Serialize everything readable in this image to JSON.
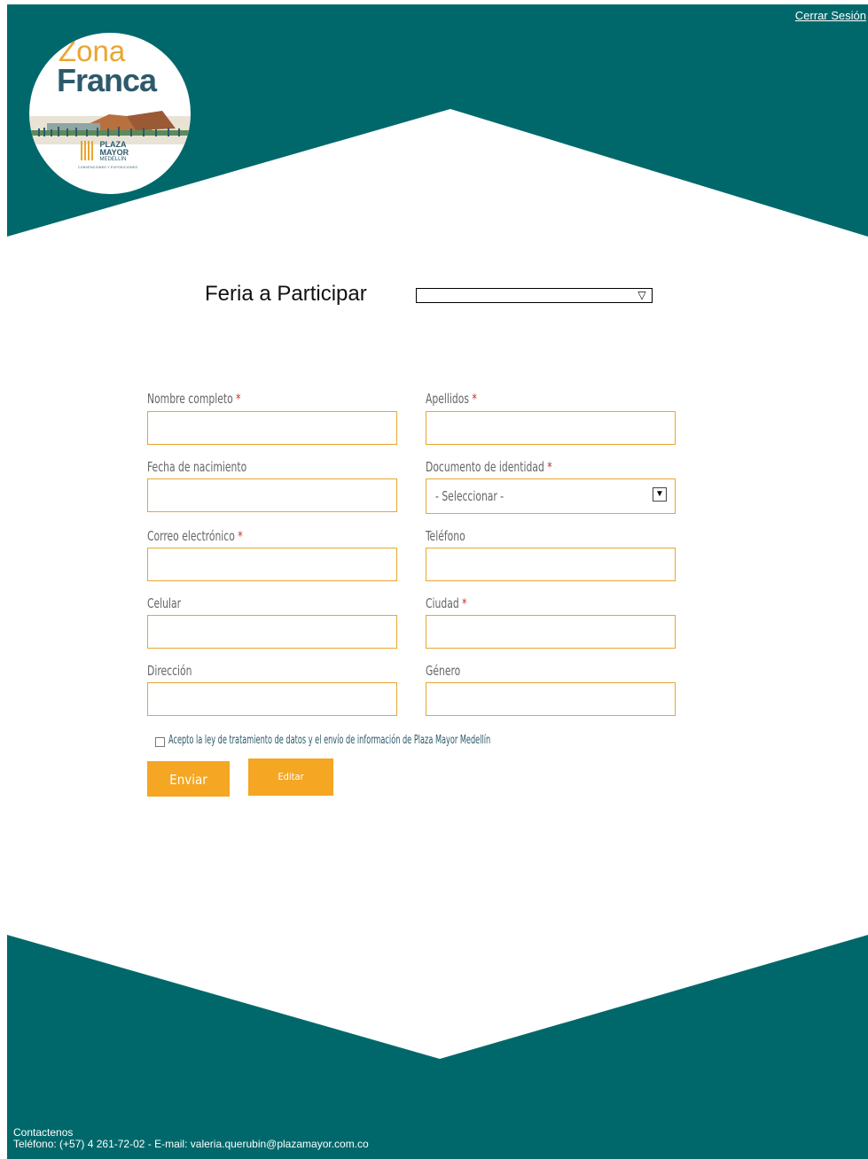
{
  "colors": {
    "teal": "#00686b",
    "orange": "#f5a623",
    "input_border": "#e8a630",
    "label": "#666666",
    "required": "#c0392b"
  },
  "header": {
    "logout_label": "Cerrar Sesión"
  },
  "logo": {
    "line1": "Zona",
    "line2": "Franca",
    "brand1": "PLAZA",
    "brand2": "MAYOR",
    "brand3": "MEDELLÍN",
    "tagline": "CONVENCIONES Y EXPOSICIONES"
  },
  "feria": {
    "label": "Feria a Participar",
    "selected": ""
  },
  "form": {
    "nombre_label": "Nombre completo",
    "apellidos_label": "Apellidos",
    "fecha_label": "Fecha de nacimiento",
    "documento_label": "Documento de identidad",
    "documento_placeholder": "- Seleccionar -",
    "correo_label": "Correo electrónico",
    "telefono_label": "Teléfono",
    "celular_label": "Celular",
    "ciudad_label": "Ciudad",
    "direccion_label": "Dirección",
    "genero_label": "Género",
    "required_mark": "*",
    "consent_text": "Acepto la ley de tratamiento de datos y el envío de información de Plaza Mayor Medellín",
    "submit_label": "Enviar",
    "edit_label": "Editar"
  },
  "footer": {
    "contact_title": "Contactenos",
    "contact_line": "Teléfono: (+57) 4 261-72-02 - E-mail: valeria.querubin@plazamayor.com.co"
  }
}
